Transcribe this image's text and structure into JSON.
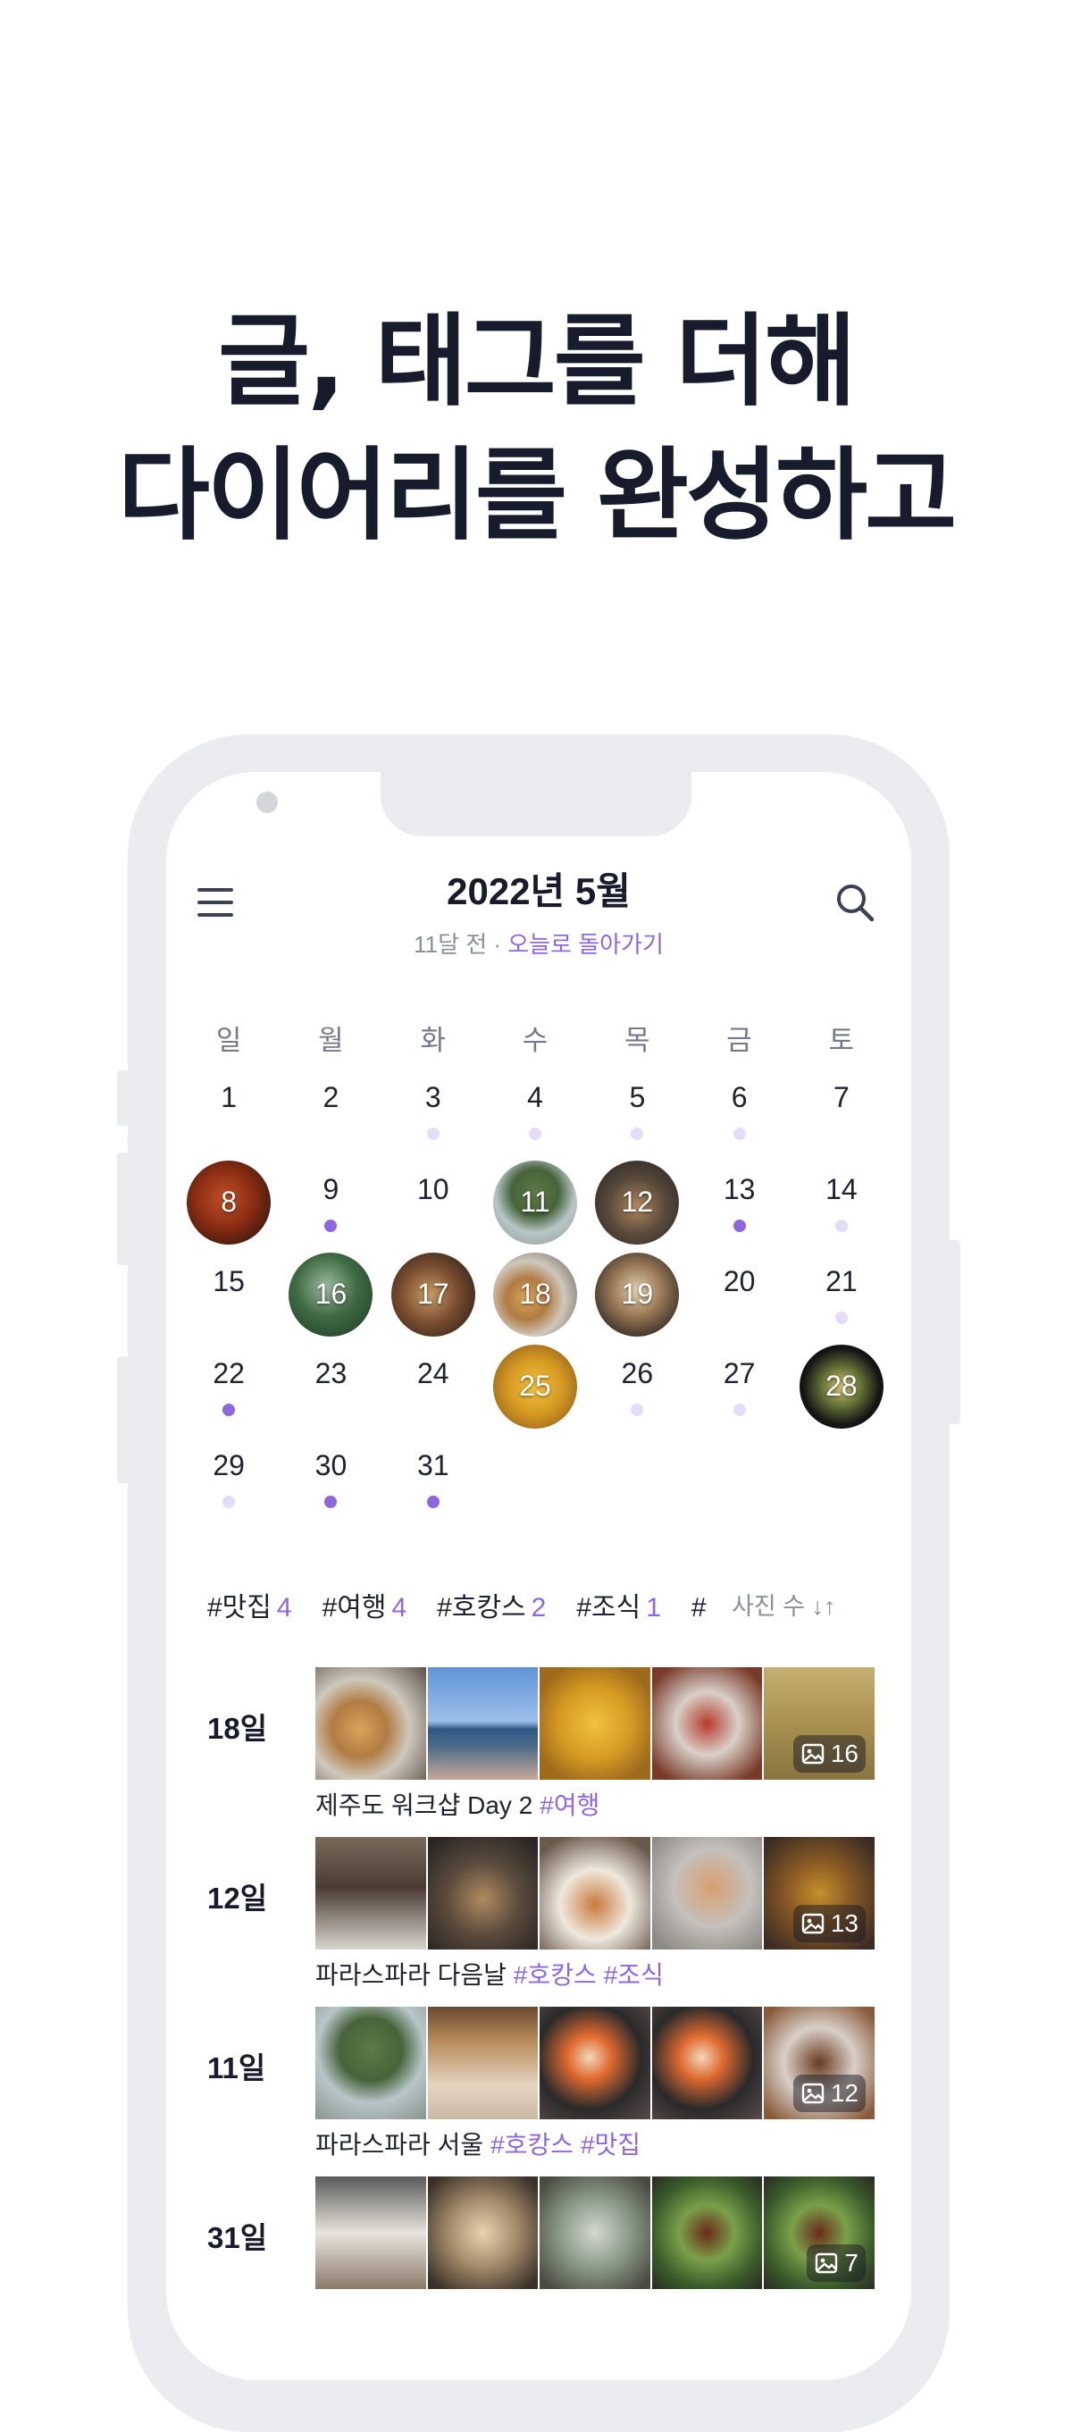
{
  "headline": {
    "line1": "글, 태그를 더해",
    "line2": "다이어리를 완성하고"
  },
  "header": {
    "title": "2022년 5월",
    "sub_prefix": "11달 전 · ",
    "sub_link": "오늘로 돌아가기"
  },
  "weekdays": [
    "일",
    "월",
    "화",
    "수",
    "목",
    "금",
    "토"
  ],
  "days": [
    {
      "n": "1",
      "dot": ""
    },
    {
      "n": "2",
      "dot": ""
    },
    {
      "n": "3",
      "dot": "light"
    },
    {
      "n": "4",
      "dot": "light"
    },
    {
      "n": "5",
      "dot": "light"
    },
    {
      "n": "6",
      "dot": "light"
    },
    {
      "n": "7",
      "dot": ""
    },
    {
      "n": "8",
      "photo": "food-red"
    },
    {
      "n": "9",
      "dot": "dark"
    },
    {
      "n": "10",
      "dot": ""
    },
    {
      "n": "11",
      "photo": "tree"
    },
    {
      "n": "12",
      "photo": "food-table"
    },
    {
      "n": "13",
      "dot": "dark"
    },
    {
      "n": "14",
      "dot": "light"
    },
    {
      "n": "15",
      "dot": ""
    },
    {
      "n": "16",
      "photo": "forest"
    },
    {
      "n": "17",
      "photo": "bakery"
    },
    {
      "n": "18",
      "photo": "tarts"
    },
    {
      "n": "19",
      "photo": "cake"
    },
    {
      "n": "20",
      "dot": ""
    },
    {
      "n": "21",
      "dot": "light"
    },
    {
      "n": "22",
      "dot": "dark"
    },
    {
      "n": "23",
      "dot": ""
    },
    {
      "n": "24",
      "dot": ""
    },
    {
      "n": "25",
      "photo": "pasta"
    },
    {
      "n": "26",
      "dot": "light"
    },
    {
      "n": "27",
      "dot": "light"
    },
    {
      "n": "28",
      "photo": "dark-plate"
    },
    {
      "n": "29",
      "dot": "light"
    },
    {
      "n": "30",
      "dot": "dark"
    },
    {
      "n": "31",
      "dot": "dark"
    }
  ],
  "tags": [
    {
      "name": "#맛집",
      "count": "4"
    },
    {
      "name": "#여행",
      "count": "4"
    },
    {
      "name": "#호캉스",
      "count": "2"
    },
    {
      "name": "#조식",
      "count": "1"
    },
    {
      "name": "#",
      "count": ""
    }
  ],
  "sort_label": "사진 수 ↓↑",
  "entries": [
    {
      "day": "18일",
      "photos": [
        "tarts",
        "sea",
        "pasta",
        "pizza",
        "room"
      ],
      "count": "16",
      "title": "제주도 워크샵 Day 2",
      "tags": [
        "#여행"
      ]
    },
    {
      "day": "12일",
      "photos": [
        "kitchen",
        "food-table",
        "breakfast",
        "bread",
        "food-basket"
      ],
      "count": "13",
      "title": "파라스파라 다음날",
      "tags": [
        "#호캉스",
        "#조식"
      ]
    },
    {
      "day": "11일",
      "photos": [
        "tree",
        "shelf",
        "sushi",
        "sushi",
        "steak"
      ],
      "count": "12",
      "title": "파라스파라 서울",
      "tags": [
        "#호캉스",
        "#맛집"
      ]
    },
    {
      "day": "31일",
      "photos": [
        "cafe",
        "dumplings",
        "plates",
        "salad",
        "salad"
      ],
      "count": "7",
      "title": "",
      "tags": []
    }
  ]
}
